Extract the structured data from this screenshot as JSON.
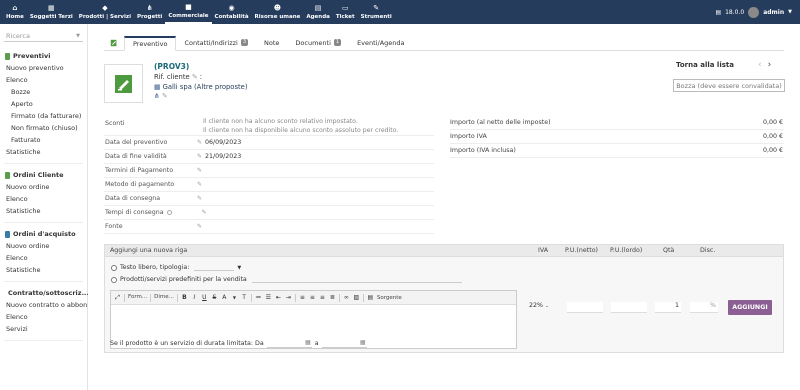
{
  "topbar": {
    "menu": [
      {
        "label": "Home",
        "icon": "home-icon",
        "glyph": "⌂"
      },
      {
        "label": "Soggetti Terzi",
        "icon": "building-icon",
        "glyph": "▦"
      },
      {
        "label": "Prodotti | Servizi",
        "icon": "cube-icon",
        "glyph": "◆"
      },
      {
        "label": "Progetti",
        "icon": "sitemap-icon",
        "glyph": "⋔"
      },
      {
        "label": "Commerciale",
        "icon": "briefcase-icon",
        "glyph": "■"
      },
      {
        "label": "Contabilità",
        "icon": "coins-icon",
        "glyph": "◉"
      },
      {
        "label": "Risorse umane",
        "icon": "people-icon",
        "glyph": "☻"
      },
      {
        "label": "Agenda",
        "icon": "calendar-icon",
        "glyph": "▤"
      },
      {
        "label": "Ticket",
        "icon": "ticket-icon",
        "glyph": "▭"
      },
      {
        "label": "Strumenti",
        "icon": "wrench-icon",
        "glyph": "✎"
      }
    ],
    "version": "18.0.0",
    "user": "admin"
  },
  "sidebar": {
    "search_placeholder": "Ricerca",
    "sections": [
      {
        "title": "Preventivi",
        "color": "#5a9e4b",
        "items": [
          {
            "label": "Nuovo preventivo",
            "sub": false
          },
          {
            "label": "Elenco",
            "sub": false
          },
          {
            "label": "Bozze",
            "sub": true
          },
          {
            "label": "Aperto",
            "sub": true
          },
          {
            "label": "Firmato (da fatturare)",
            "sub": true
          },
          {
            "label": "Non firmato (chiuso)",
            "sub": true
          },
          {
            "label": "Fatturato",
            "sub": true
          },
          {
            "label": "Statistiche",
            "sub": false
          }
        ]
      },
      {
        "title": "Ordini Cliente",
        "color": "#5a9e4b",
        "items": [
          {
            "label": "Nuovo ordine",
            "sub": false
          },
          {
            "label": "Elenco",
            "sub": false
          },
          {
            "label": "Statistiche",
            "sub": false
          }
        ]
      },
      {
        "title": "Ordini d'acquisto",
        "color": "#3a7ca5",
        "items": [
          {
            "label": "Nuovo ordine",
            "sub": false
          },
          {
            "label": "Elenco",
            "sub": false
          },
          {
            "label": "Statistiche",
            "sub": false
          }
        ]
      },
      {
        "title": "Contratto/sottoscriz...",
        "color": "#5a9e4b",
        "items": [
          {
            "label": "Nuovo contratto o abbon...",
            "sub": false
          },
          {
            "label": "Elenco",
            "sub": false
          },
          {
            "label": "Servizi",
            "sub": false
          }
        ]
      }
    ]
  },
  "tabs": [
    {
      "label": "Preventivo",
      "badge": null
    },
    {
      "label": "Contatti/Indirizzi",
      "badge": "3"
    },
    {
      "label": "Note",
      "badge": null
    },
    {
      "label": "Documenti",
      "badge": "1"
    },
    {
      "label": "Eventi/Agenda",
      "badge": null
    }
  ],
  "header": {
    "ref": "(PROV3)",
    "client_ref_label": "Rif. cliente",
    "client_ref_suffix": ":",
    "thirdparty": "Galli spa (Altre proposte)",
    "back_link": "Torna alla lista",
    "status": "Bozza (deve essere convalidata)"
  },
  "fields": {
    "discounts_label": "Sconti",
    "discount_note_1": "Il cliente non ha alcuno sconto relativo impostato.",
    "discount_note_2": "Il cliente non ha disponibile alcuno sconto assoluto per credito.",
    "rows": [
      {
        "label": "Data del preventivo",
        "value": "06/09/2023"
      },
      {
        "label": "Data di fine validità",
        "value": "21/09/2023"
      },
      {
        "label": "Termini di Pagamento",
        "value": ""
      },
      {
        "label": "Metodo di pagamento",
        "value": ""
      },
      {
        "label": "Data di consegna",
        "value": ""
      },
      {
        "label": "Tempi di consegna",
        "value": ""
      },
      {
        "label": "Fonte",
        "value": ""
      }
    ]
  },
  "totals": [
    {
      "label": "Importo (al netto delle imposte)",
      "value": "0,00 €"
    },
    {
      "label": "Importo IVA",
      "value": "0,00 €"
    },
    {
      "label": "Importo (IVA inclusa)",
      "value": "0,00 €"
    }
  ],
  "addline": {
    "title": "Aggiungi una nuova riga",
    "col_vat": "IVA",
    "col_pu_net": "P.U.(netto)",
    "col_pu_gross": "P.U.(lordo)",
    "col_qty": "Qtà",
    "col_disc": "Disc.",
    "opt_free": "Testo libero, tipologia:",
    "opt_predef": "Prodotti/servizi predefiniti per la vendita",
    "editor_format": "Form...",
    "editor_size": "Dime...",
    "editor_source": "Sorgente",
    "vat_value": "22%",
    "qty_value": "1",
    "percent": "%",
    "add_button": "AGGIUNGI",
    "duration_label": "Se il prodotto è un servizio di durata limitata: Da",
    "duration_to": "a"
  }
}
